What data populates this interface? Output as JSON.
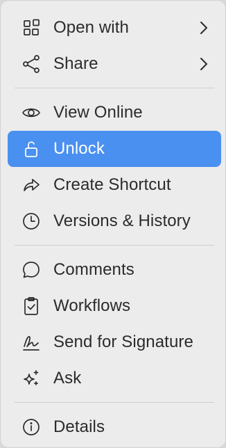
{
  "menu": {
    "items": [
      {
        "label": "Open with",
        "icon": "open-with-icon"
      },
      {
        "label": "Share",
        "icon": "share-icon"
      },
      {
        "label": "View Online",
        "icon": "eye-icon"
      },
      {
        "label": "Unlock",
        "icon": "unlock-icon",
        "highlighted": true
      },
      {
        "label": "Create Shortcut",
        "icon": "shortcut-arrow-icon"
      },
      {
        "label": "Versions & History",
        "icon": "clock-icon"
      },
      {
        "label": "Comments",
        "icon": "comment-icon"
      },
      {
        "label": "Workflows",
        "icon": "clipboard-check-icon"
      },
      {
        "label": "Send for Signature",
        "icon": "signature-icon"
      },
      {
        "label": "Ask",
        "icon": "sparkles-icon"
      },
      {
        "label": "Details",
        "icon": "info-icon"
      }
    ]
  },
  "colors": {
    "highlight": "#4a90f0",
    "menu_background": "#ececec",
    "text": "#2b2b2b"
  }
}
